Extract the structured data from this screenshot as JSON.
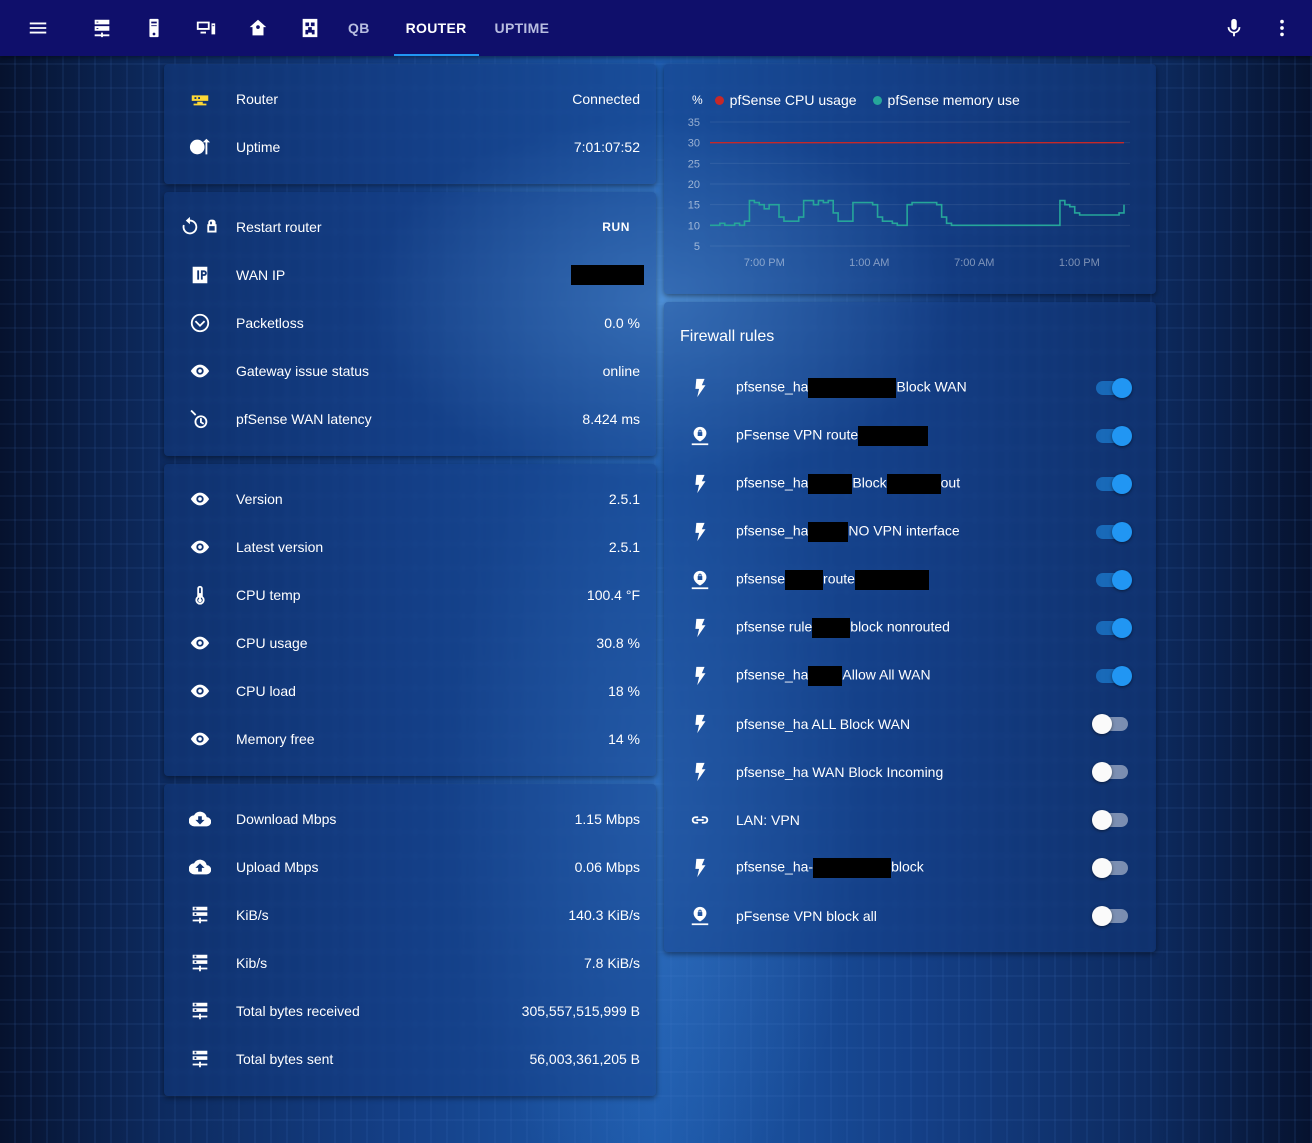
{
  "toolbar": {
    "tabs": [
      {
        "label": "QB",
        "active": false
      },
      {
        "label": "ROUTER",
        "active": true
      },
      {
        "label": "UPTIME",
        "active": false
      }
    ],
    "accent": "#2196f3",
    "background": "#0f0f6b"
  },
  "status_card": {
    "rows": [
      {
        "icon": "router-icon",
        "label": "Router",
        "value": "Connected"
      },
      {
        "icon": "clock-up-icon",
        "label": "Uptime",
        "value": "7:01:07:52"
      }
    ]
  },
  "control_card": {
    "restart": {
      "label": "Restart router",
      "action": "RUN"
    },
    "rows": [
      {
        "icon": "ip-icon",
        "label": "WAN IP",
        "value": ""
      },
      {
        "icon": "chevron-circle-icon",
        "label": "Packetloss",
        "value": "0.0 %"
      },
      {
        "icon": "eye-icon",
        "label": "Gateway issue status",
        "value": "online"
      },
      {
        "icon": "timer-icon",
        "label": "pfSense WAN latency",
        "value": "8.424 ms"
      }
    ]
  },
  "system_card": {
    "rows": [
      {
        "icon": "eye-icon",
        "label": "Version",
        "value": "2.5.1"
      },
      {
        "icon": "eye-icon",
        "label": "Latest version",
        "value": "2.5.1"
      },
      {
        "icon": "thermometer-icon",
        "label": "CPU temp",
        "value": "100.4 °F"
      },
      {
        "icon": "eye-icon",
        "label": "CPU usage",
        "value": "30.8 %"
      },
      {
        "icon": "eye-icon",
        "label": "CPU load",
        "value": "18 %"
      },
      {
        "icon": "eye-icon",
        "label": "Memory free",
        "value": "14 %"
      }
    ]
  },
  "traffic_card": {
    "rows": [
      {
        "icon": "cloud-download-icon",
        "label": "Download Mbps",
        "value": "1.15 Mbps"
      },
      {
        "icon": "cloud-upload-icon",
        "label": "Upload Mbps",
        "value": "0.06 Mbps"
      },
      {
        "icon": "server-icon",
        "label": "KiB/s",
        "value": "140.3 KiB/s"
      },
      {
        "icon": "server-icon",
        "label": "Kib/s",
        "value": "7.8 KiB/s"
      },
      {
        "icon": "server-icon",
        "label": "Total bytes received",
        "value": "305,557,515,999 B"
      },
      {
        "icon": "server-icon",
        "label": "Total bytes sent",
        "value": "56,003,361,205 B"
      }
    ]
  },
  "chart_data": {
    "type": "line",
    "title": "",
    "ylabel": "%",
    "ylim": [
      5,
      35
    ],
    "yticks": [
      "35",
      "30",
      "25",
      "20",
      "15",
      "10",
      "5"
    ],
    "xticks": [
      "7:00 PM",
      "1:00 AM",
      "7:00 AM",
      "1:00 PM"
    ],
    "series": [
      {
        "name": "pfSense CPU usage",
        "color": "#c62828",
        "values": [
          30,
          30,
          30,
          30,
          30,
          30,
          30,
          30,
          30,
          30,
          30,
          30,
          30,
          30,
          30,
          30,
          30,
          30,
          30,
          30,
          30,
          30,
          30,
          30,
          30,
          30,
          30,
          30,
          30,
          30,
          30,
          30,
          30,
          30,
          30,
          30,
          30,
          30,
          30,
          30,
          30,
          30,
          30,
          30,
          30,
          30,
          30,
          30,
          30,
          30,
          30,
          30,
          30,
          30,
          30,
          30,
          30,
          30,
          30,
          30,
          30,
          30,
          30,
          30,
          30,
          30,
          30,
          30,
          30,
          30,
          30,
          30,
          30,
          30,
          30,
          30,
          30,
          30,
          30,
          30
        ]
      },
      {
        "name": "pfSense memory use",
        "color": "#26a69a",
        "values": [
          10,
          10,
          10.5,
          10,
          10,
          10.5,
          10,
          11,
          16,
          15.5,
          15,
          14,
          15,
          15,
          12,
          11,
          11,
          11,
          12,
          16,
          16,
          15,
          16,
          15.5,
          16,
          13,
          11,
          11,
          11,
          15.5,
          15.5,
          15.5,
          15.5,
          15,
          12,
          11,
          11,
          10.5,
          10,
          10,
          15,
          15.5,
          15.5,
          15.5,
          15.5,
          15.5,
          15,
          12,
          10.5,
          10,
          10,
          10,
          10,
          10,
          10,
          10,
          10,
          10,
          10,
          10,
          10,
          10,
          10,
          10,
          10,
          10,
          10,
          10,
          10,
          10,
          10,
          16,
          15,
          14.5,
          13,
          12.5,
          12.5,
          12.5,
          12.5,
          12.5,
          12.5,
          12.5,
          12.5,
          13,
          15
        ]
      }
    ]
  },
  "firewall": {
    "title": "Firewall rules",
    "rules": [
      {
        "icon": "flash-icon",
        "parts": [
          "pfsense_ha",
          "Block WAN"
        ],
        "redact": [
          88
        ],
        "on": true
      },
      {
        "icon": "vpn-icon",
        "parts": [
          "pFsense VPN route",
          ""
        ],
        "redact": [
          70
        ],
        "on": true
      },
      {
        "icon": "flash-icon",
        "parts": [
          "pfsense_ha",
          "Block",
          "out"
        ],
        "redact": [
          44,
          54
        ],
        "on": true
      },
      {
        "icon": "flash-icon",
        "parts": [
          "pfsense_ha",
          "NO VPN interface"
        ],
        "redact": [
          40
        ],
        "on": true
      },
      {
        "icon": "vpn-icon",
        "parts": [
          "pfsense",
          "route",
          ""
        ],
        "redact": [
          38,
          74
        ],
        "on": true
      },
      {
        "icon": "flash-icon",
        "parts": [
          "pfsense rule",
          "block nonrouted"
        ],
        "redact": [
          38
        ],
        "on": true
      },
      {
        "icon": "flash-icon",
        "parts": [
          "pfsense_ha",
          "Allow All WAN"
        ],
        "redact": [
          34
        ],
        "on": true
      },
      {
        "icon": "flash-icon",
        "parts": [
          "pfsense_ha ALL Block WAN"
        ],
        "redact": [],
        "on": false
      },
      {
        "icon": "flash-icon",
        "parts": [
          "pfsense_ha WAN Block Incoming"
        ],
        "redact": [],
        "on": false
      },
      {
        "icon": "link-icon",
        "parts": [
          "LAN: VPN"
        ],
        "redact": [],
        "on": false
      },
      {
        "icon": "flash-icon",
        "parts": [
          "pfsense_ha-",
          "block"
        ],
        "redact": [
          78
        ],
        "on": false
      },
      {
        "icon": "vpn-icon",
        "parts": [
          "pFsense VPN block all"
        ],
        "redact": [],
        "on": false
      }
    ]
  }
}
